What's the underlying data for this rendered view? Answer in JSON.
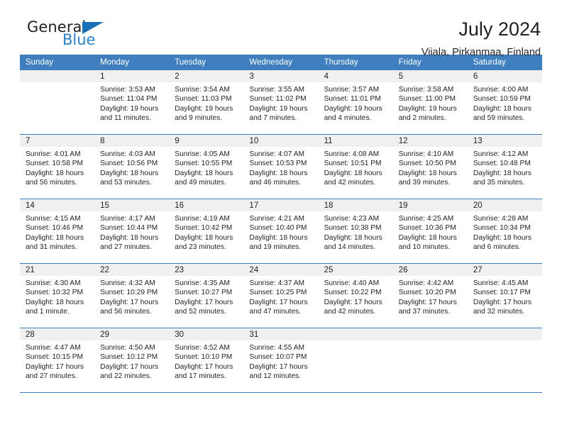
{
  "logo": {
    "word_one": "General",
    "word_two": "Blue",
    "icon": "triangle-logo-mark",
    "accent_color": "#2980c4"
  },
  "header": {
    "title": "July 2024",
    "subtitle": "Viiala, Pirkanmaa, Finland"
  },
  "theme": {
    "header_row_bg": "#3f7fbf",
    "daynum_bg": "#f0f0f0",
    "text_color": "#231f20"
  },
  "calendar": {
    "weekday_headers": [
      "Sunday",
      "Monday",
      "Tuesday",
      "Wednesday",
      "Thursday",
      "Friday",
      "Saturday"
    ],
    "weeks": [
      [
        {
          "day": "",
          "empty": true,
          "sunrise": "",
          "sunset": "",
          "daylight1": "",
          "daylight2": ""
        },
        {
          "day": "1",
          "sunrise": "Sunrise: 3:53 AM",
          "sunset": "Sunset: 11:04 PM",
          "daylight1": "Daylight: 19 hours",
          "daylight2": "and 11 minutes."
        },
        {
          "day": "2",
          "sunrise": "Sunrise: 3:54 AM",
          "sunset": "Sunset: 11:03 PM",
          "daylight1": "Daylight: 19 hours",
          "daylight2": "and 9 minutes."
        },
        {
          "day": "3",
          "sunrise": "Sunrise: 3:55 AM",
          "sunset": "Sunset: 11:02 PM",
          "daylight1": "Daylight: 19 hours",
          "daylight2": "and 7 minutes."
        },
        {
          "day": "4",
          "sunrise": "Sunrise: 3:57 AM",
          "sunset": "Sunset: 11:01 PM",
          "daylight1": "Daylight: 19 hours",
          "daylight2": "and 4 minutes."
        },
        {
          "day": "5",
          "sunrise": "Sunrise: 3:58 AM",
          "sunset": "Sunset: 11:00 PM",
          "daylight1": "Daylight: 19 hours",
          "daylight2": "and 2 minutes."
        },
        {
          "day": "6",
          "sunrise": "Sunrise: 4:00 AM",
          "sunset": "Sunset: 10:59 PM",
          "daylight1": "Daylight: 18 hours",
          "daylight2": "and 59 minutes."
        }
      ],
      [
        {
          "day": "7",
          "sunrise": "Sunrise: 4:01 AM",
          "sunset": "Sunset: 10:58 PM",
          "daylight1": "Daylight: 18 hours",
          "daylight2": "and 56 minutes."
        },
        {
          "day": "8",
          "sunrise": "Sunrise: 4:03 AM",
          "sunset": "Sunset: 10:56 PM",
          "daylight1": "Daylight: 18 hours",
          "daylight2": "and 53 minutes."
        },
        {
          "day": "9",
          "sunrise": "Sunrise: 4:05 AM",
          "sunset": "Sunset: 10:55 PM",
          "daylight1": "Daylight: 18 hours",
          "daylight2": "and 49 minutes."
        },
        {
          "day": "10",
          "sunrise": "Sunrise: 4:07 AM",
          "sunset": "Sunset: 10:53 PM",
          "daylight1": "Daylight: 18 hours",
          "daylight2": "and 46 minutes."
        },
        {
          "day": "11",
          "sunrise": "Sunrise: 4:08 AM",
          "sunset": "Sunset: 10:51 PM",
          "daylight1": "Daylight: 18 hours",
          "daylight2": "and 42 minutes."
        },
        {
          "day": "12",
          "sunrise": "Sunrise: 4:10 AM",
          "sunset": "Sunset: 10:50 PM",
          "daylight1": "Daylight: 18 hours",
          "daylight2": "and 39 minutes."
        },
        {
          "day": "13",
          "sunrise": "Sunrise: 4:12 AM",
          "sunset": "Sunset: 10:48 PM",
          "daylight1": "Daylight: 18 hours",
          "daylight2": "and 35 minutes."
        }
      ],
      [
        {
          "day": "14",
          "sunrise": "Sunrise: 4:15 AM",
          "sunset": "Sunset: 10:46 PM",
          "daylight1": "Daylight: 18 hours",
          "daylight2": "and 31 minutes."
        },
        {
          "day": "15",
          "sunrise": "Sunrise: 4:17 AM",
          "sunset": "Sunset: 10:44 PM",
          "daylight1": "Daylight: 18 hours",
          "daylight2": "and 27 minutes."
        },
        {
          "day": "16",
          "sunrise": "Sunrise: 4:19 AM",
          "sunset": "Sunset: 10:42 PM",
          "daylight1": "Daylight: 18 hours",
          "daylight2": "and 23 minutes."
        },
        {
          "day": "17",
          "sunrise": "Sunrise: 4:21 AM",
          "sunset": "Sunset: 10:40 PM",
          "daylight1": "Daylight: 18 hours",
          "daylight2": "and 19 minutes."
        },
        {
          "day": "18",
          "sunrise": "Sunrise: 4:23 AM",
          "sunset": "Sunset: 10:38 PM",
          "daylight1": "Daylight: 18 hours",
          "daylight2": "and 14 minutes."
        },
        {
          "day": "19",
          "sunrise": "Sunrise: 4:25 AM",
          "sunset": "Sunset: 10:36 PM",
          "daylight1": "Daylight: 18 hours",
          "daylight2": "and 10 minutes."
        },
        {
          "day": "20",
          "sunrise": "Sunrise: 4:28 AM",
          "sunset": "Sunset: 10:34 PM",
          "daylight1": "Daylight: 18 hours",
          "daylight2": "and 6 minutes."
        }
      ],
      [
        {
          "day": "21",
          "sunrise": "Sunrise: 4:30 AM",
          "sunset": "Sunset: 10:32 PM",
          "daylight1": "Daylight: 18 hours",
          "daylight2": "and 1 minute."
        },
        {
          "day": "22",
          "sunrise": "Sunrise: 4:32 AM",
          "sunset": "Sunset: 10:29 PM",
          "daylight1": "Daylight: 17 hours",
          "daylight2": "and 56 minutes."
        },
        {
          "day": "23",
          "sunrise": "Sunrise: 4:35 AM",
          "sunset": "Sunset: 10:27 PM",
          "daylight1": "Daylight: 17 hours",
          "daylight2": "and 52 minutes."
        },
        {
          "day": "24",
          "sunrise": "Sunrise: 4:37 AM",
          "sunset": "Sunset: 10:25 PM",
          "daylight1": "Daylight: 17 hours",
          "daylight2": "and 47 minutes."
        },
        {
          "day": "25",
          "sunrise": "Sunrise: 4:40 AM",
          "sunset": "Sunset: 10:22 PM",
          "daylight1": "Daylight: 17 hours",
          "daylight2": "and 42 minutes."
        },
        {
          "day": "26",
          "sunrise": "Sunrise: 4:42 AM",
          "sunset": "Sunset: 10:20 PM",
          "daylight1": "Daylight: 17 hours",
          "daylight2": "and 37 minutes."
        },
        {
          "day": "27",
          "sunrise": "Sunrise: 4:45 AM",
          "sunset": "Sunset: 10:17 PM",
          "daylight1": "Daylight: 17 hours",
          "daylight2": "and 32 minutes."
        }
      ],
      [
        {
          "day": "28",
          "sunrise": "Sunrise: 4:47 AM",
          "sunset": "Sunset: 10:15 PM",
          "daylight1": "Daylight: 17 hours",
          "daylight2": "and 27 minutes."
        },
        {
          "day": "29",
          "sunrise": "Sunrise: 4:50 AM",
          "sunset": "Sunset: 10:12 PM",
          "daylight1": "Daylight: 17 hours",
          "daylight2": "and 22 minutes."
        },
        {
          "day": "30",
          "sunrise": "Sunrise: 4:52 AM",
          "sunset": "Sunset: 10:10 PM",
          "daylight1": "Daylight: 17 hours",
          "daylight2": "and 17 minutes."
        },
        {
          "day": "31",
          "sunrise": "Sunrise: 4:55 AM",
          "sunset": "Sunset: 10:07 PM",
          "daylight1": "Daylight: 17 hours",
          "daylight2": "and 12 minutes."
        },
        {
          "day": "",
          "empty": true,
          "sunrise": "",
          "sunset": "",
          "daylight1": "",
          "daylight2": ""
        },
        {
          "day": "",
          "empty": true,
          "sunrise": "",
          "sunset": "",
          "daylight1": "",
          "daylight2": ""
        },
        {
          "day": "",
          "empty": true,
          "sunrise": "",
          "sunset": "",
          "daylight1": "",
          "daylight2": ""
        }
      ]
    ]
  }
}
